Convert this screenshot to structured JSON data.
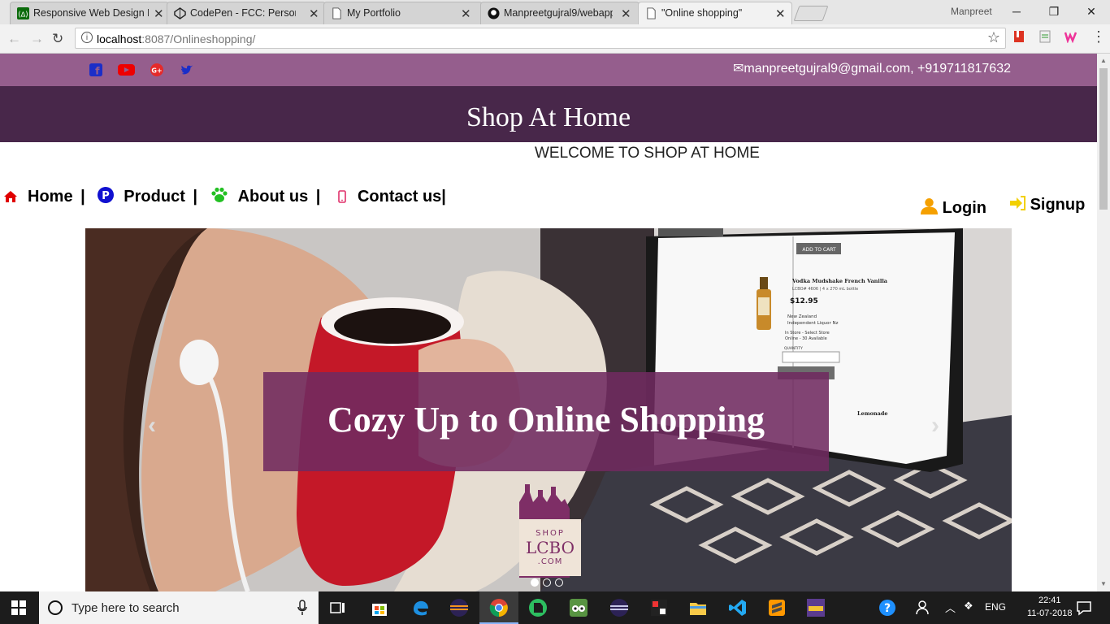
{
  "browser": {
    "tabs": [
      {
        "title": "Responsive Web Design P",
        "icon": "fcc-icon",
        "active": false
      },
      {
        "title": "CodePen - FCC: Personal",
        "icon": "codepen-icon",
        "active": false
      },
      {
        "title": "My Portfolio",
        "icon": "page-icon",
        "active": false
      },
      {
        "title": "Manpreetgujral9/webapp",
        "icon": "github-icon",
        "active": false
      },
      {
        "title": "\"Online shopping\"",
        "icon": "page-icon",
        "active": true
      }
    ],
    "profile_name": "Manpreet",
    "url_host": "localhost",
    "url_rest": ":8087/Onlineshopping/"
  },
  "page": {
    "contact": "manpreetgujral9@gmail.com, +919711817632",
    "site_title": "Shop At Home",
    "welcome": "WELCOME TO SHOP AT HOME",
    "nav": [
      {
        "label": "Home",
        "sep": " |",
        "icon": "home-icon",
        "color": "#e00000"
      },
      {
        "label": "Product",
        "sep": " |",
        "icon": "product-p-icon",
        "color": "#1010d0"
      },
      {
        "label": "About us",
        "sep": " |",
        "icon": "paw-icon",
        "color": "#22c022"
      },
      {
        "label": "Contact us",
        "sep": "|",
        "icon": "mobile-icon",
        "color": "#e0306a"
      }
    ],
    "login": "Login",
    "signup": "Signup",
    "carousel": {
      "caption": "Cozy Up to Online Shopping",
      "logo_lines": [
        "SHOP",
        "LCBO",
        ".COM"
      ],
      "slides": 3,
      "active_slide": 1,
      "screen": {
        "product": "Vodka Mudshake French Vanilla",
        "meta": "LCBO# 4606 | 4 x 270 mL bottle",
        "price": "$12.95",
        "origin": "New Zealand",
        "maker": "Independent Liquor Nz",
        "add_to_cart": "ADD TO CART",
        "quantity": "QUANTITY",
        "in_store": "In Store - Select Store",
        "online": "Online - 30 Available",
        "lemonade": "Lemonade"
      }
    }
  },
  "taskbar": {
    "search_placeholder": "Type here to search",
    "lang": "ENG",
    "time": "22:41",
    "date": "11-07-2018"
  },
  "colors": {
    "topbar": "#955e8d",
    "header": "#48274a",
    "caption_bg": "#702a60"
  }
}
